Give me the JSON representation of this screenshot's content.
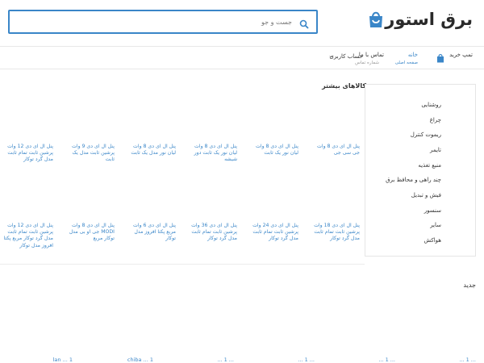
{
  "header": {
    "logo_text": "برق استور",
    "search_placeholder": "جست و جو"
  },
  "nav": {
    "cart_label": "تمپ خرید",
    "home_label": "خانه",
    "home_sub": "صفحه اصلی",
    "contact_label": "تماس با ما",
    "contact_sub": "شماره تماس",
    "account_label": "حساب کاربری"
  },
  "sidebar": {
    "items": [
      "روشنایی",
      "چراغ",
      "ریموت کنترل",
      "تایمر",
      "منبع تغذیه",
      "چند راهی و محافظ برق",
      "فیش و تبدیل",
      "سنسور",
      "سایر",
      "هواکش"
    ]
  },
  "sections": {
    "more_title": "کالاهای بیشتر",
    "new_title": "جدید"
  },
  "products": {
    "row1": [
      "پنل ال ای دی 8 وات جی سی جی",
      "پنل ال ای دی 8 وات لیان نور یک ثابت",
      "پنل ال ای دی 8 وات لیان نور یک ثابت دور شیشه",
      "پنل ال ای دی 8 وات لیان نور مدل یک ثابت",
      "پنل ال ای دی 9 وات پرشین ثابت مدل یک ثابت",
      "پنل ال ای دی 12 وات پرشین ثابت تمام ثابت مدل گرد توکار"
    ],
    "row2": [
      "پنل ال ای دی 18 وات پرشین ثابت تمام ثابت مدل گرد توکار",
      "پنل ال ای دی 24 وات پرشین ثابت تمام ثابت مدل گرد توکار",
      "پنل ال ای دی 36 وات پرشین ثابت تمام ثابت مدل گرد توکار",
      "پنل ال ای دی 6 وات مربع پکتا افروز مدل توکار",
      "پنل ال ای دی 8 وات MODI جی او بی مدل توکار مربع",
      "پنل ال ای دی 12 وات پرشین ثابت تمام ثابت مدل گرد توکار مربع پکتا افروز مدل توکار"
    ]
  },
  "bottom": {
    "items": [
      "... 1 ...",
      "... 1 ...",
      "... 1 ...",
      "... 1 ...",
      "chiba ... 1",
      "lan ... 1"
    ]
  },
  "colors": {
    "accent": "#3a86c8",
    "text": "#333333",
    "border": "#e5e5e5"
  }
}
